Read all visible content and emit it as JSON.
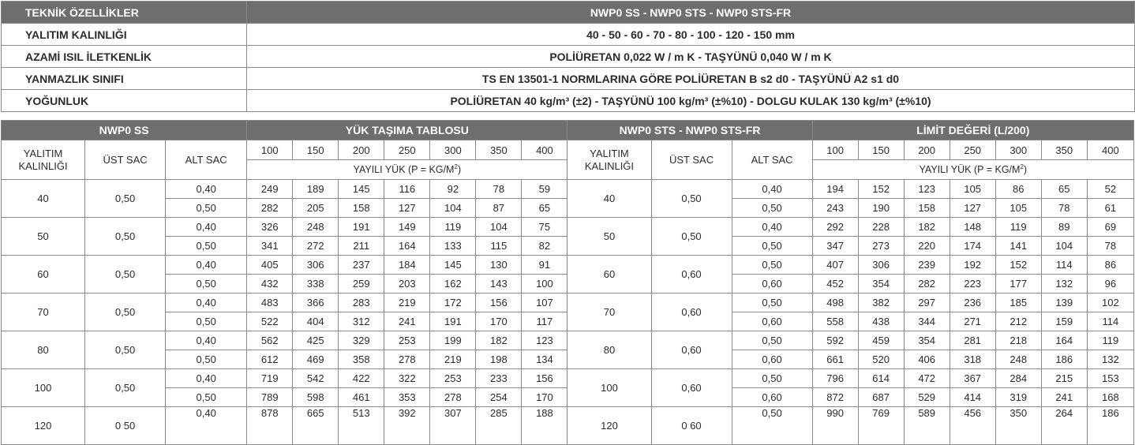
{
  "spec": {
    "header_label": "TEKNİK ÖZELLİKLER",
    "header_value": "NWP0 SS - NWP0 STS - NWP0 STS-FR",
    "rows": [
      {
        "label": "YALITIM KALINLIĞI",
        "value": "40  -  50  -  60  -  70  -  80  -  100  -  120 - 150 mm"
      },
      {
        "label": "AZAMİ ISIL İLETKENLİK",
        "value": "POLİÜRETAN        0,022 W / m K   -   TAŞYÜNÜ        0,040 W / m K"
      },
      {
        "label": "YANMAZLIK SINIFI",
        "value": "TS EN 13501-1 NORMLARINA GÖRE  POLİÜRETAN B s2 d0   -   TAŞYÜNÜ A2 s1 d0"
      },
      {
        "label": "YOĞUNLUK",
        "value": "POLİÜRETAN  40 kg/m³ (±2)  -  TAŞYÜNÜ   100 kg/m³ (±%10)  -  DOLGU KULAK 130 kg/m³ (±%10)"
      }
    ]
  },
  "load_table": {
    "left_title": "NWP0 SS",
    "left_subtitle": "YÜK TAŞIMA TABLOSU",
    "right_title": "NWP0 STS - NWP0 STS-FR",
    "right_subtitle": "LİMİT DEĞERİ (L/200)",
    "col_insulation": "YALITIM KALINLIĞI",
    "col_top": "ÜST SAC",
    "col_bottom": "ALT SAC",
    "spans": [
      "100",
      "150",
      "200",
      "250",
      "300",
      "350",
      "400"
    ],
    "distributed_load_prefix": "YAYILI YÜK (P = KG/M",
    "distributed_load_sup": "2",
    "distributed_load_suffix": ")",
    "left_groups": [
      {
        "thickness": "40",
        "top": "0,50",
        "rows": [
          {
            "bottom": "0,40",
            "values": [
              "249",
              "189",
              "145",
              "116",
              "92",
              "78",
              "59"
            ]
          },
          {
            "bottom": "0,50",
            "values": [
              "282",
              "205",
              "158",
              "127",
              "104",
              "87",
              "65"
            ]
          }
        ]
      },
      {
        "thickness": "50",
        "top": "0,50",
        "rows": [
          {
            "bottom": "0,40",
            "values": [
              "326",
              "248",
              "191",
              "149",
              "119",
              "104",
              "75"
            ]
          },
          {
            "bottom": "0,50",
            "values": [
              "341",
              "272",
              "211",
              "164",
              "133",
              "115",
              "82"
            ]
          }
        ]
      },
      {
        "thickness": "60",
        "top": "0,50",
        "rows": [
          {
            "bottom": "0,40",
            "values": [
              "405",
              "306",
              "237",
              "184",
              "145",
              "130",
              "91"
            ]
          },
          {
            "bottom": "0,50",
            "values": [
              "432",
              "338",
              "259",
              "203",
              "162",
              "143",
              "100"
            ]
          }
        ]
      },
      {
        "thickness": "70",
        "top": "0,50",
        "rows": [
          {
            "bottom": "0,40",
            "values": [
              "483",
              "366",
              "283",
              "219",
              "172",
              "156",
              "107"
            ]
          },
          {
            "bottom": "0,50",
            "values": [
              "522",
              "404",
              "312",
              "241",
              "191",
              "170",
              "117"
            ]
          }
        ]
      },
      {
        "thickness": "80",
        "top": "0,50",
        "rows": [
          {
            "bottom": "0,40",
            "values": [
              "562",
              "425",
              "329",
              "253",
              "199",
              "182",
              "123"
            ]
          },
          {
            "bottom": "0,50",
            "values": [
              "612",
              "469",
              "358",
              "278",
              "219",
              "198",
              "134"
            ]
          }
        ]
      },
      {
        "thickness": "100",
        "top": "0,50",
        "rows": [
          {
            "bottom": "0,40",
            "values": [
              "719",
              "542",
              "422",
              "322",
              "253",
              "233",
              "156"
            ]
          },
          {
            "bottom": "0,50",
            "values": [
              "789",
              "598",
              "461",
              "353",
              "278",
              "254",
              "170"
            ]
          }
        ]
      },
      {
        "thickness": "120",
        "top": "0 50",
        "rows": [
          {
            "bottom": "0,40",
            "values": [
              "878",
              "665",
              "513",
              "392",
              "307",
              "285",
              "188"
            ]
          }
        ]
      }
    ],
    "right_groups": [
      {
        "thickness": "40",
        "top": "0,50",
        "rows": [
          {
            "bottom": "0,40",
            "values": [
              "194",
              "152",
              "123",
              "105",
              "86",
              "65",
              "52"
            ]
          },
          {
            "bottom": "0,50",
            "values": [
              "243",
              "190",
              "158",
              "127",
              "105",
              "78",
              "61"
            ]
          }
        ]
      },
      {
        "thickness": "50",
        "top": "0,50",
        "rows": [
          {
            "bottom": "0,40",
            "values": [
              "292",
              "228",
              "182",
              "148",
              "119",
              "89",
              "69"
            ]
          },
          {
            "bottom": "0,50",
            "values": [
              "347",
              "273",
              "220",
              "174",
              "141",
              "104",
              "78"
            ]
          }
        ]
      },
      {
        "thickness": "60",
        "top": "0,60",
        "rows": [
          {
            "bottom": "0,50",
            "values": [
              "407",
              "306",
              "239",
              "192",
              "152",
              "114",
              "86"
            ]
          },
          {
            "bottom": "0,60",
            "values": [
              "452",
              "354",
              "282",
              "223",
              "177",
              "132",
              "96"
            ]
          }
        ]
      },
      {
        "thickness": "70",
        "top": "0,60",
        "rows": [
          {
            "bottom": "0,50",
            "values": [
              "498",
              "382",
              "297",
              "236",
              "185",
              "139",
              "102"
            ]
          },
          {
            "bottom": "0,60",
            "values": [
              "558",
              "438",
              "344",
              "271",
              "212",
              "159",
              "114"
            ]
          }
        ]
      },
      {
        "thickness": "80",
        "top": "0,60",
        "rows": [
          {
            "bottom": "0,50",
            "values": [
              "592",
              "459",
              "354",
              "281",
              "218",
              "164",
              "119"
            ]
          },
          {
            "bottom": "0,60",
            "values": [
              "661",
              "520",
              "406",
              "318",
              "248",
              "186",
              "132"
            ]
          }
        ]
      },
      {
        "thickness": "100",
        "top": "0,60",
        "rows": [
          {
            "bottom": "0,50",
            "values": [
              "796",
              "614",
              "472",
              "367",
              "284",
              "215",
              "153"
            ]
          },
          {
            "bottom": "0,60",
            "values": [
              "872",
              "687",
              "529",
              "414",
              "319",
              "241",
              "168"
            ]
          }
        ]
      },
      {
        "thickness": "120",
        "top": "0 60",
        "rows": [
          {
            "bottom": "0,50",
            "values": [
              "990",
              "769",
              "589",
              "456",
              "350",
              "264",
              "186"
            ]
          }
        ]
      }
    ]
  }
}
